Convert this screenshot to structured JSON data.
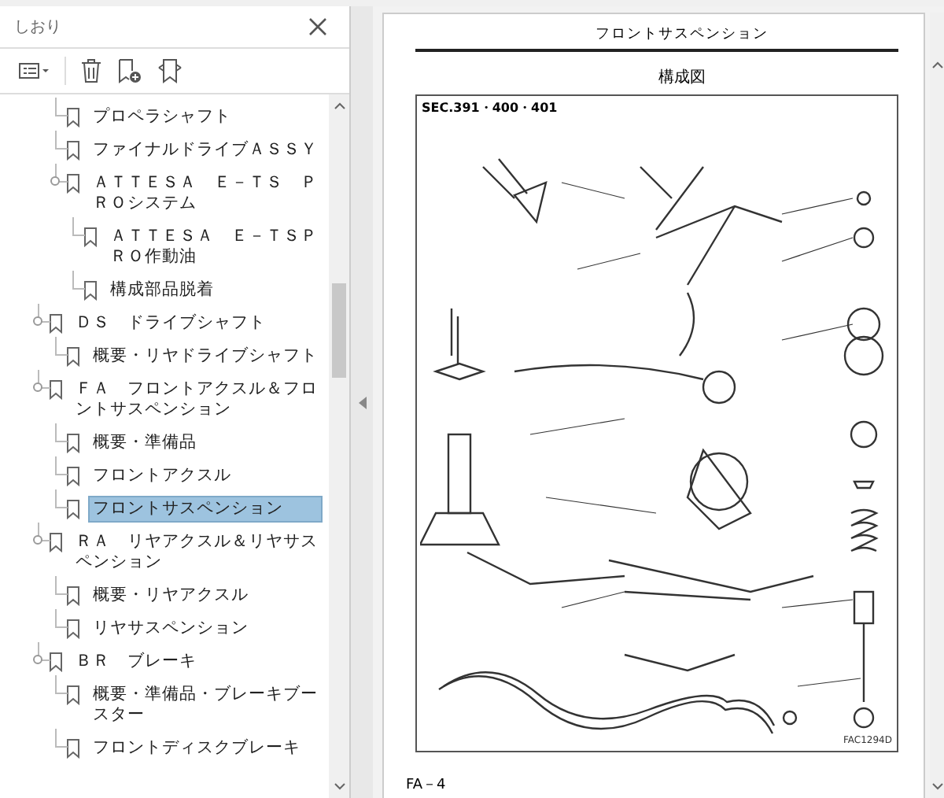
{
  "panel": {
    "title": "しおり"
  },
  "bookmarks": [
    {
      "children": [
        {
          "label": "プロペラシャフト",
          "selected": false
        },
        {
          "label": "ファイナルドライブＡＳＳＹ",
          "selected": false
        },
        {
          "label": "ＡＴＴＥＳＡ　Ｅ－ＴＳ　ＰＲＯシステム",
          "selected": false,
          "expanded": true,
          "children": [
            {
              "label": "ＡＴＴＥＳＡ　Ｅ－ＴＳＰＲＯ作動油",
              "selected": false
            },
            {
              "label": "構成部品脱着",
              "selected": false
            }
          ]
        }
      ]
    },
    {
      "label": "ＤＳ　ドライブシャフト",
      "selected": false,
      "expanded": true,
      "children": [
        {
          "label": "概要・リヤドライブシャフト",
          "selected": false
        }
      ]
    },
    {
      "label": "ＦＡ　フロントアクスル＆フロントサスペンション",
      "selected": false,
      "expanded": true,
      "children": [
        {
          "label": "概要・準備品",
          "selected": false
        },
        {
          "label": "フロントアクスル",
          "selected": false
        },
        {
          "label": "フロントサスペンション",
          "selected": true
        }
      ]
    },
    {
      "label": "ＲＡ　リヤアクスル＆リヤサスペンション",
      "selected": false,
      "expanded": true,
      "children": [
        {
          "label": "概要・リヤアクスル",
          "selected": false
        },
        {
          "label": "リヤサスペンション",
          "selected": false
        }
      ]
    },
    {
      "label": "ＢＲ　ブレーキ",
      "selected": false,
      "expanded": true,
      "children": [
        {
          "label": "概要・準備品・ブレーキブースター",
          "selected": false
        },
        {
          "label": "フロントディスクブレーキ",
          "selected": false
        }
      ]
    }
  ],
  "document": {
    "page_title": "フロントサスペンション",
    "heading": "構成図",
    "figure": {
      "section_code": "SEC.391・400・401",
      "figure_code": "FAC1294D"
    },
    "page_number": "FA－4"
  }
}
